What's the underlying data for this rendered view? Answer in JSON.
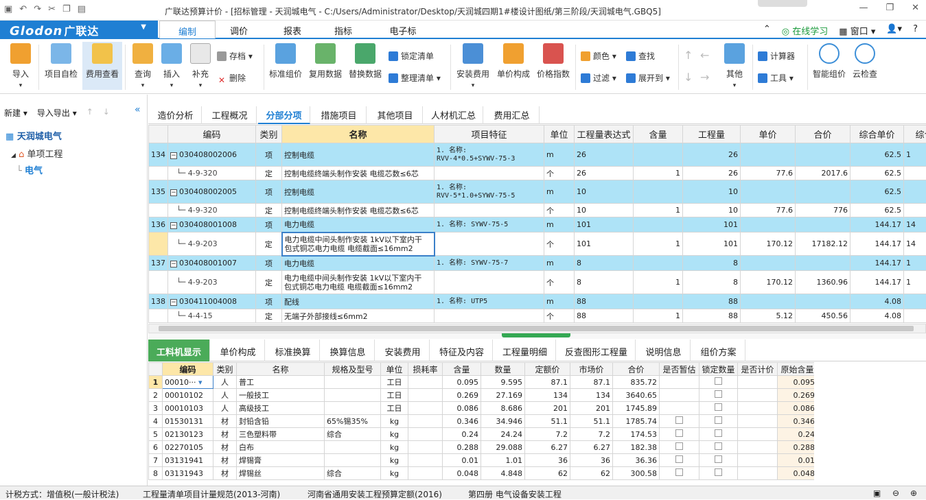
{
  "titlebar": {
    "title": "广联达预算计价 - [招标管理 - 天润城电气 - C:/Users/Administrator/Desktop/天润城四期1#楼设计图纸/第三阶段/天润城电气.GBQ5]"
  },
  "logo": {
    "brand": "Glodon",
    "cn": "广联达"
  },
  "menus": [
    "编制",
    "调价",
    "报表",
    "指标",
    "电子标"
  ],
  "menu_right": {
    "online": "在线学习",
    "window": "窗口"
  },
  "ribbon": {
    "import": "导入",
    "self_check": "项目自检",
    "fee_view": "费用查看",
    "query": "查询",
    "insert": "插入",
    "supplement": "补充",
    "save": "存档",
    "delete": "删除",
    "std_price": "标准组价",
    "reuse": "复用数据",
    "replace": "替换数据",
    "lock": "锁定清单",
    "arrange": "整理清单",
    "install_fee": "安装费用",
    "unit_comp": "单价构成",
    "price_index": "价格指数",
    "color": "颜色",
    "find": "查找",
    "filter": "过滤",
    "expand": "展开到",
    "other": "其他",
    "calculator": "计算器",
    "tools": "工具",
    "smart_price": "智能组价",
    "cloud_check": "云检查"
  },
  "left": {
    "new": "新建",
    "io": "导入导出",
    "project": "天润城电气",
    "single": "单项工程",
    "unit": "电气"
  },
  "tabs": [
    "造价分析",
    "工程概况",
    "分部分项",
    "措施项目",
    "其他项目",
    "人材机汇总",
    "费用汇总"
  ],
  "grid": {
    "headers": [
      "",
      "编码",
      "类别",
      "名称",
      "项目特征",
      "单位",
      "工程量表达式",
      "含量",
      "工程量",
      "单价",
      "合价",
      "综合单价",
      "综合"
    ],
    "rows": [
      {
        "type": "q",
        "no": "134",
        "code": "030408002006",
        "cat": "项",
        "name": "控制电缆",
        "feat1": "1. 名称:",
        "feat2": "RVV-4*0.5+SYWV-75-3",
        "unit": "m",
        "expr": "26",
        "qty": "26",
        "up": "",
        "tp": "",
        "cup": "62.5",
        "c2": "1"
      },
      {
        "type": "d",
        "no": "",
        "code": "4-9-320",
        "cat": "定",
        "name": "控制电缆终端头制作安装 电缆芯数≤6芯",
        "feat1": "",
        "feat2": "",
        "unit": "个",
        "expr": "26",
        "content": "1",
        "qty": "26",
        "up": "77.6",
        "tp": "2017.6",
        "cup": "62.5",
        "c2": ""
      },
      {
        "type": "q",
        "no": "135",
        "code": "030408002005",
        "cat": "项",
        "name": "控制电缆",
        "feat1": "1. 名称:",
        "feat2": "RVV-5*1.0+SYWV-75-5",
        "unit": "m",
        "expr": "10",
        "qty": "10",
        "up": "",
        "tp": "",
        "cup": "62.5",
        "c2": ""
      },
      {
        "type": "d",
        "no": "",
        "code": "4-9-320",
        "cat": "定",
        "name": "控制电缆终端头制作安装 电缆芯数≤6芯",
        "feat1": "",
        "feat2": "",
        "unit": "个",
        "expr": "10",
        "content": "1",
        "qty": "10",
        "up": "77.6",
        "tp": "776",
        "cup": "62.5",
        "c2": ""
      },
      {
        "type": "q",
        "no": "136",
        "code": "030408001008",
        "cat": "项",
        "name": "电力电缆",
        "feat1": "1. 名称: SYWV-75-5",
        "feat2": "",
        "unit": "m",
        "expr": "101",
        "qty": "101",
        "up": "",
        "tp": "",
        "cup": "144.17",
        "c2": "14"
      },
      {
        "type": "d",
        "no": "",
        "code": "4-9-203",
        "cat": "定",
        "name": "电力电缆中间头制作安装 1kV以下室内干",
        "name2": "包式铜芯电力电缆 电缆截面≤16mm2",
        "feat1": "",
        "feat2": "",
        "unit": "个",
        "expr": "101",
        "content": "1",
        "qty": "101",
        "up": "170.12",
        "tp": "17182.12",
        "cup": "144.17",
        "c2": "14"
      },
      {
        "type": "q",
        "no": "137",
        "code": "030408001007",
        "cat": "项",
        "name": "电力电缆",
        "feat1": "1. 名称: SYWV-75-7",
        "feat2": "",
        "unit": "m",
        "expr": "8",
        "qty": "8",
        "up": "",
        "tp": "",
        "cup": "144.17",
        "c2": "1"
      },
      {
        "type": "d",
        "no": "",
        "code": "4-9-203",
        "cat": "定",
        "name": "电力电缆中间头制作安装 1kV以下室内干",
        "name2": "包式铜芯电力电缆 电缆截面≤16mm2",
        "feat1": "",
        "feat2": "",
        "unit": "个",
        "expr": "8",
        "content": "1",
        "qty": "8",
        "up": "170.12",
        "tp": "1360.96",
        "cup": "144.17",
        "c2": "1"
      },
      {
        "type": "q",
        "no": "138",
        "code": "030411004008",
        "cat": "项",
        "name": "配线",
        "feat1": "1. 名称: UTP5",
        "feat2": "",
        "unit": "m",
        "expr": "88",
        "qty": "88",
        "up": "",
        "tp": "",
        "cup": "4.08",
        "c2": ""
      },
      {
        "type": "d",
        "no": "",
        "code": "4-4-15",
        "cat": "定",
        "name": "无端子外部接线≤6mm2",
        "feat1": "",
        "feat2": "",
        "unit": "个",
        "expr": "88",
        "content": "1",
        "qty": "88",
        "up": "5.12",
        "tp": "450.56",
        "cup": "4.08",
        "c2": ""
      }
    ]
  },
  "btabs": [
    "工料机显示",
    "单价构成",
    "标准换算",
    "换算信息",
    "安装费用",
    "特征及内容",
    "工程量明细",
    "反查图形工程量",
    "说明信息",
    "组价方案"
  ],
  "bgrid": {
    "headers": [
      "",
      "编码",
      "类别",
      "名称",
      "规格及型号",
      "单位",
      "损耗率",
      "含量",
      "数量",
      "定额价",
      "市场价",
      "合价",
      "是否暂估",
      "锁定数量",
      "是否计价",
      "原始含量"
    ],
    "rows": [
      {
        "no": "1",
        "code": "00010···",
        "cat": "人",
        "name": "普工",
        "spec": "",
        "unit": "工日",
        "content": "0.095",
        "qty": "9.595",
        "dp": "87.1",
        "mp": "87.1",
        "tp": "835.72",
        "est": false,
        "orig": "0.095"
      },
      {
        "no": "2",
        "code": "00010102",
        "cat": "人",
        "name": "一般技工",
        "spec": "",
        "unit": "工日",
        "content": "0.269",
        "qty": "27.169",
        "dp": "134",
        "mp": "134",
        "tp": "3640.65",
        "est": false,
        "orig": "0.269"
      },
      {
        "no": "3",
        "code": "00010103",
        "cat": "人",
        "name": "高级技工",
        "spec": "",
        "unit": "工日",
        "content": "0.086",
        "qty": "8.686",
        "dp": "201",
        "mp": "201",
        "tp": "1745.89",
        "est": false,
        "orig": "0.086"
      },
      {
        "no": "4",
        "code": "01530131",
        "cat": "材",
        "name": "封铅含铅",
        "spec": "65%锡35%",
        "unit": "kg",
        "content": "0.346",
        "qty": "34.946",
        "dp": "51.1",
        "mp": "51.1",
        "tp": "1785.74",
        "est": true,
        "orig": "0.346"
      },
      {
        "no": "5",
        "code": "02130123",
        "cat": "材",
        "name": "三色塑料带",
        "spec": "综合",
        "unit": "kg",
        "content": "0.24",
        "qty": "24.24",
        "dp": "7.2",
        "mp": "7.2",
        "tp": "174.53",
        "est": true,
        "orig": "0.24"
      },
      {
        "no": "6",
        "code": "02270105",
        "cat": "材",
        "name": "白布",
        "spec": "",
        "unit": "kg",
        "content": "0.288",
        "qty": "29.088",
        "dp": "6.27",
        "mp": "6.27",
        "tp": "182.38",
        "est": true,
        "orig": "0.288"
      },
      {
        "no": "7",
        "code": "03131941",
        "cat": "材",
        "name": "焊锡膏",
        "spec": "",
        "unit": "kg",
        "content": "0.01",
        "qty": "1.01",
        "dp": "36",
        "mp": "36",
        "tp": "36.36",
        "est": true,
        "orig": "0.01"
      },
      {
        "no": "8",
        "code": "03131943",
        "cat": "材",
        "name": "焊锡丝",
        "spec": "综合",
        "unit": "kg",
        "content": "0.048",
        "qty": "4.848",
        "dp": "62",
        "mp": "62",
        "tp": "300.58",
        "est": true,
        "orig": "0.048"
      }
    ]
  },
  "status": {
    "tax": "计税方式：增值税(一般计税法)",
    "rule": "工程量清单项目计量规范(2013-河南)",
    "quota": "河南省通用安装工程预算定额(2016)",
    "book": "第四册 电气设备安装工程"
  }
}
